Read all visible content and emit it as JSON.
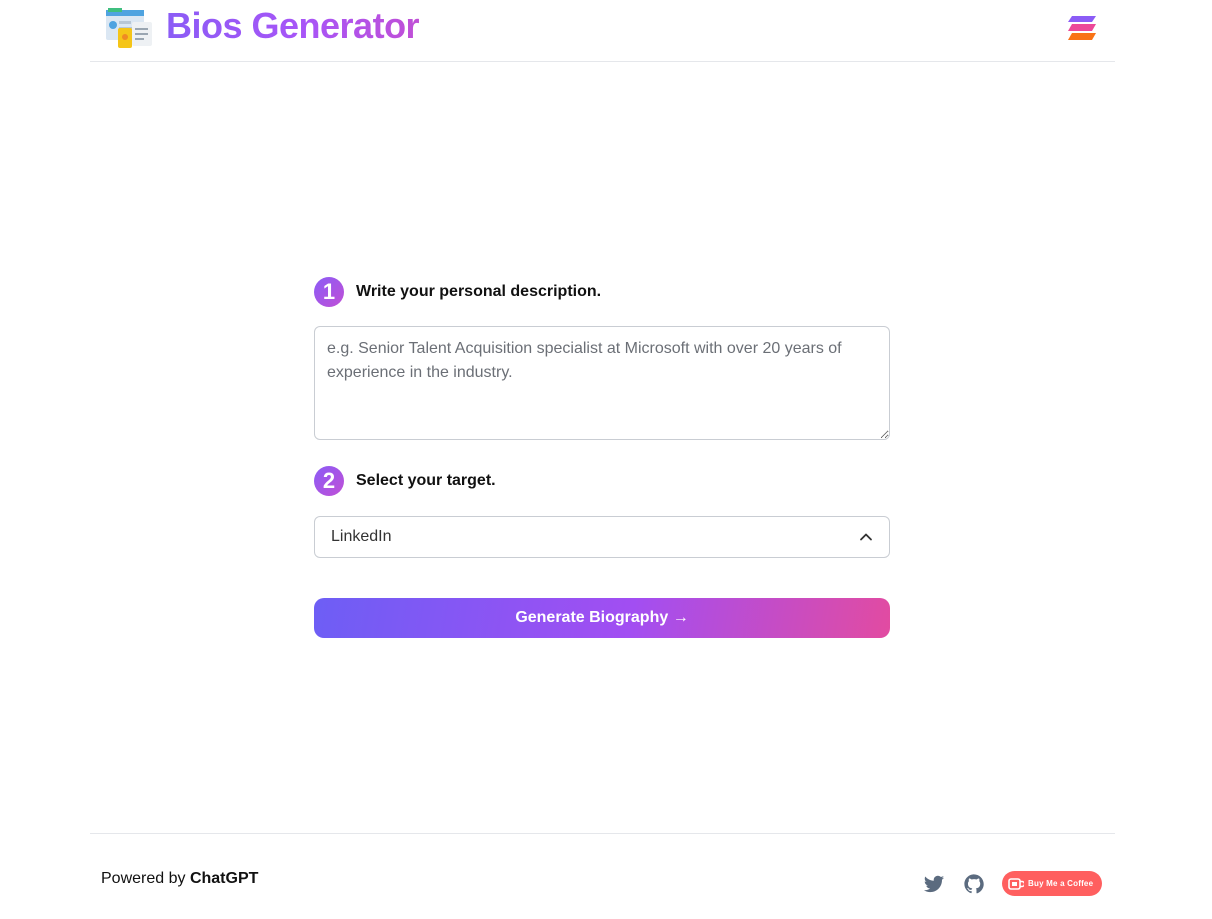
{
  "header": {
    "title": "Bios Generator"
  },
  "form": {
    "step1": {
      "number": "1",
      "label": "Write your personal description."
    },
    "description": {
      "value": "",
      "placeholder": "e.g. Senior Talent Acquisition specialist at Microsoft with over 20 years of experience in the industry."
    },
    "step2": {
      "number": "2",
      "label": "Select your target."
    },
    "target": {
      "selected": "LinkedIn"
    },
    "generate_label": "Generate Biography →"
  },
  "footer": {
    "powered_prefix": "Powered by",
    "powered_brand": "ChatGPT",
    "bmc_label": "Buy Me a Coffee"
  },
  "colors": {
    "accent": "#a855f7",
    "button_start": "#6d5ef5",
    "button_end": "#e24ba1",
    "bmc_bg": "#ff5f5f"
  },
  "icons": [
    "app-logo-icon",
    "menu-stack-icon",
    "chevron-up-icon",
    "twitter-icon",
    "github-icon",
    "coffee-cup-icon"
  ]
}
